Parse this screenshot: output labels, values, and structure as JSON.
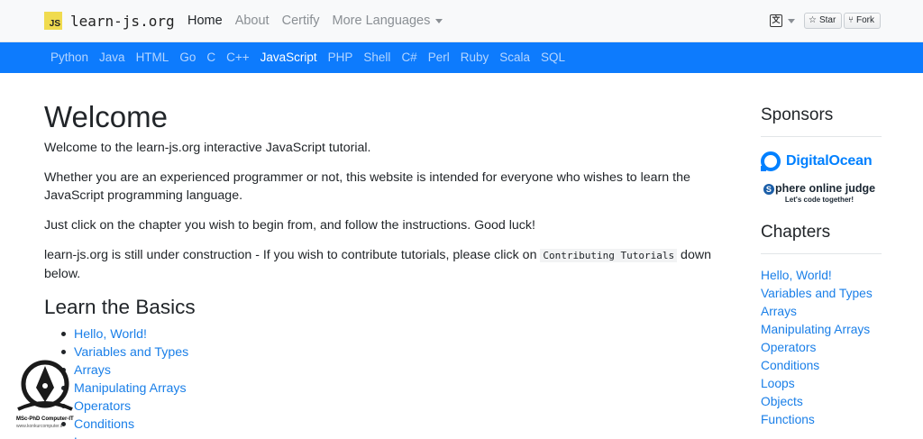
{
  "brand": {
    "logo_text": "JS",
    "name": "learn-js.org"
  },
  "topnav": {
    "items": [
      {
        "label": "Home",
        "active": true
      },
      {
        "label": "About",
        "active": false
      },
      {
        "label": "Certify",
        "active": false
      },
      {
        "label": "More Languages",
        "active": false,
        "dropdown": true
      }
    ]
  },
  "github": {
    "star_label": "Star",
    "fork_label": "Fork"
  },
  "language_bar": {
    "items": [
      "Python",
      "Java",
      "HTML",
      "Go",
      "C",
      "C++",
      "JavaScript",
      "PHP",
      "Shell",
      "C#",
      "Perl",
      "Ruby",
      "Scala",
      "SQL"
    ],
    "active": "JavaScript"
  },
  "main": {
    "title": "Welcome",
    "intro": "Welcome to the learn-js.org interactive JavaScript tutorial.",
    "para2": "Whether you are an experienced programmer or not, this website is intended for everyone who wishes to learn the JavaScript programming language.",
    "para3": "Just click on the chapter you wish to begin from, and follow the instructions. Good luck!",
    "para4_before": "learn-js.org is still under construction - If you wish to contribute tutorials, please click on ",
    "para4_code": "Contributing Tutorials",
    "para4_after": " down below.",
    "basics_title": "Learn the Basics",
    "basics": [
      "Hello, World!",
      "Variables and Types",
      "Arrays",
      "Manipulating Arrays",
      "Operators",
      "Conditions",
      "Loops"
    ]
  },
  "sidebar": {
    "sponsors_title": "Sponsors",
    "sponsor1": "DigitalOcean",
    "sponsor2_name": "phere online judge",
    "sponsor2_initial": "S",
    "sponsor2_tagline": "Let's code together!",
    "chapters_title": "Chapters",
    "chapters": [
      "Hello, World!",
      "Variables and Types",
      "Arrays",
      "Manipulating Arrays",
      "Operators",
      "Conditions",
      "Loops",
      "Objects",
      "Functions"
    ]
  },
  "watermark": {
    "line1": "MSc-PhD Computer-IT",
    "line2": "www.konkurcomputer.ir"
  },
  "colors": {
    "accent": "#0d7bfd",
    "link": "#1a7fe8",
    "do_blue": "#0080ff",
    "js_yellow": "#f0db4f"
  },
  "icons": {
    "language": "translate-icon",
    "star": "star-icon",
    "fork": "fork-icon",
    "watermark": "pen-nib-logo-icon"
  }
}
